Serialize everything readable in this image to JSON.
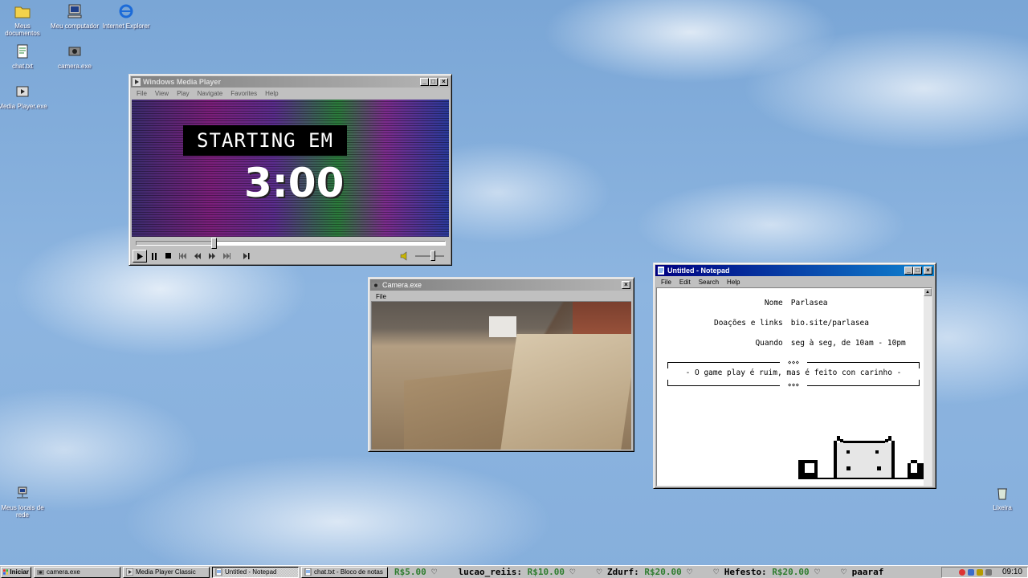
{
  "desktop": {
    "icons": [
      {
        "label": "Meus documentos",
        "icon": "folder-icon"
      },
      {
        "label": "Meu computador",
        "icon": "computer-icon"
      },
      {
        "label": "Internet Explorer",
        "icon": "ie-icon"
      },
      {
        "label": "chat.txt",
        "icon": "text-file-icon"
      },
      {
        "label": "camera.exe",
        "icon": "camera-icon"
      },
      {
        "label": "Media Player.exe",
        "icon": "media-player-icon"
      },
      {
        "label": "Meus locais de rede",
        "icon": "network-icon"
      },
      {
        "label": "Lixeira",
        "icon": "recycle-bin-icon"
      }
    ]
  },
  "media_player": {
    "title": "Windows Media Player",
    "menu": [
      "File",
      "View",
      "Play",
      "Navigate",
      "Favorites",
      "Help"
    ],
    "banner": "STARTING EM",
    "timer": "3:00",
    "seek_fraction": 0.25,
    "volume_fraction": 0.6
  },
  "camera": {
    "title": "Camera.exe",
    "menu": [
      "File"
    ]
  },
  "notepad": {
    "title": "Untitled - Notepad",
    "menu": [
      "File",
      "Edit",
      "Search",
      "Help"
    ],
    "rows": [
      {
        "label": "Nome",
        "value": "Parlasea"
      },
      {
        "label": "Doações e links",
        "value": "bio.site/parlasea"
      },
      {
        "label": "Quando",
        "value": "seg à seg, de 10am - 10pm"
      }
    ],
    "decoration": "⋄⋄⋄",
    "message": "- O game play é ruim, mas é feito con carinho -"
  },
  "taskbar": {
    "start_label": "Iniciar",
    "tasks": [
      {
        "label": "camera.exe",
        "pressed": false
      },
      {
        "label": "Media Player Classic",
        "pressed": false
      },
      {
        "label": "Untitled - Notepad",
        "pressed": true
      },
      {
        "label": "chat.txt - Bloco de notas",
        "pressed": false
      }
    ],
    "ticker": [
      {
        "name": "",
        "amount": "R$5.00"
      },
      {
        "name": "lucao_reiis:",
        "amount": "R$10.00"
      },
      {
        "name": "Zdurf:",
        "amount": "R$20.00"
      },
      {
        "name": "Hefesto:",
        "amount": "R$20.00"
      },
      {
        "name": "paaraf",
        "amount": ""
      }
    ],
    "clock": "09:10"
  },
  "colors": {
    "title_active": "#000080",
    "window_face": "#c0c0c0",
    "ticker_amount": "#2f7d2f",
    "sky": "#86afdc"
  }
}
